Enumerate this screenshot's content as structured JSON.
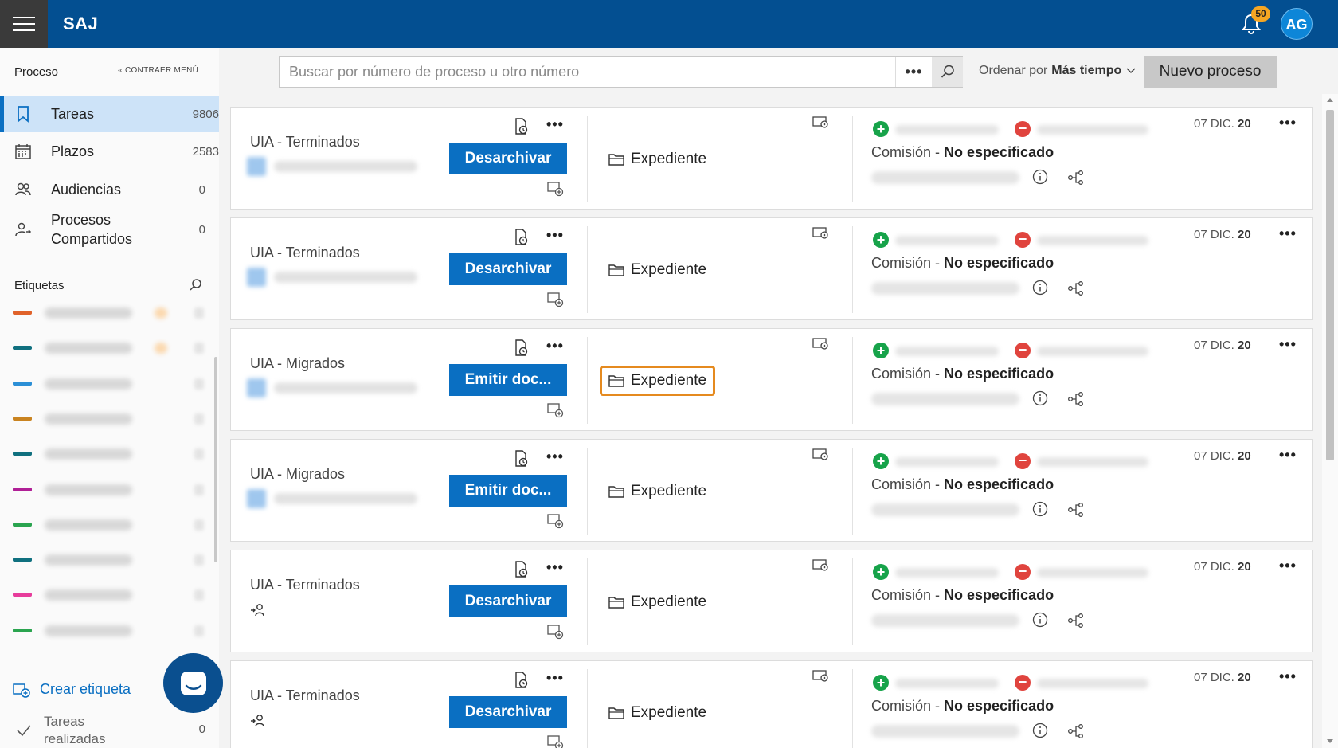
{
  "app": {
    "brand": "SAJ"
  },
  "header": {
    "notification_count": "50",
    "avatar_initials": "AG"
  },
  "sidebar": {
    "title": "Proceso",
    "collapse_label": "CONTRAER MENÚ",
    "items": [
      {
        "label": "Tareas",
        "count": "9806",
        "icon": "bookmark-icon",
        "active": true
      },
      {
        "label": "Plazos",
        "count": "2583",
        "icon": "calendar-icon",
        "active": false
      },
      {
        "label": "Audiencias",
        "count": "0",
        "icon": "people-icon",
        "active": false
      },
      {
        "label": "Procesos Compartidos",
        "count": "0",
        "icon": "shared-user-icon",
        "active": false
      }
    ],
    "tags_title": "Etiquetas",
    "tag_colors": [
      "#e0622a",
      "#10707f",
      "#2b8fd6",
      "#c98320",
      "#10707f",
      "#b01f96",
      "#2aa44f",
      "#10707f",
      "#e73c9b",
      "#2aa44f"
    ],
    "create_tag_label": "Crear etiqueta",
    "done_label": "Tareas realizadas",
    "done_count": "0"
  },
  "toolbar": {
    "search_placeholder": "Buscar por número de proceso u otro número",
    "sort_prefix": "Ordenar por",
    "sort_value": "Más tiempo",
    "new_button": "Nuevo proceso"
  },
  "cards": [
    {
      "title": "UIA - Terminados",
      "button": "Desarchivar",
      "folder_label": "Expediente",
      "commission": "Comisión",
      "commission_value": "No especificado",
      "date": "07 DIC.",
      "date_year": "20",
      "has_person": false,
      "highlight": false
    },
    {
      "title": "UIA - Terminados",
      "button": "Desarchivar",
      "folder_label": "Expediente",
      "commission": "Comisión",
      "commission_value": "No especificado",
      "date": "07 DIC.",
      "date_year": "20",
      "has_person": false,
      "highlight": false
    },
    {
      "title": "UIA - Migrados",
      "button": "Emitir doc...",
      "folder_label": "Expediente",
      "commission": "Comisión",
      "commission_value": "No especificado",
      "date": "07 DIC.",
      "date_year": "20",
      "has_person": false,
      "highlight": true
    },
    {
      "title": "UIA - Migrados",
      "button": "Emitir doc...",
      "folder_label": "Expediente",
      "commission": "Comisión",
      "commission_value": "No especificado",
      "date": "07 DIC.",
      "date_year": "20",
      "has_person": false,
      "highlight": false
    },
    {
      "title": "UIA - Terminados",
      "button": "Desarchivar",
      "folder_label": "Expediente",
      "commission": "Comisión",
      "commission_value": "No especificado",
      "date": "07 DIC.",
      "date_year": "20",
      "has_person": true,
      "highlight": false
    },
    {
      "title": "UIA - Terminados",
      "button": "Desarchivar",
      "folder_label": "Expediente",
      "commission": "Comisión",
      "commission_value": "No especificado",
      "date": "07 DIC.",
      "date_year": "20",
      "has_person": true,
      "highlight": false
    }
  ]
}
